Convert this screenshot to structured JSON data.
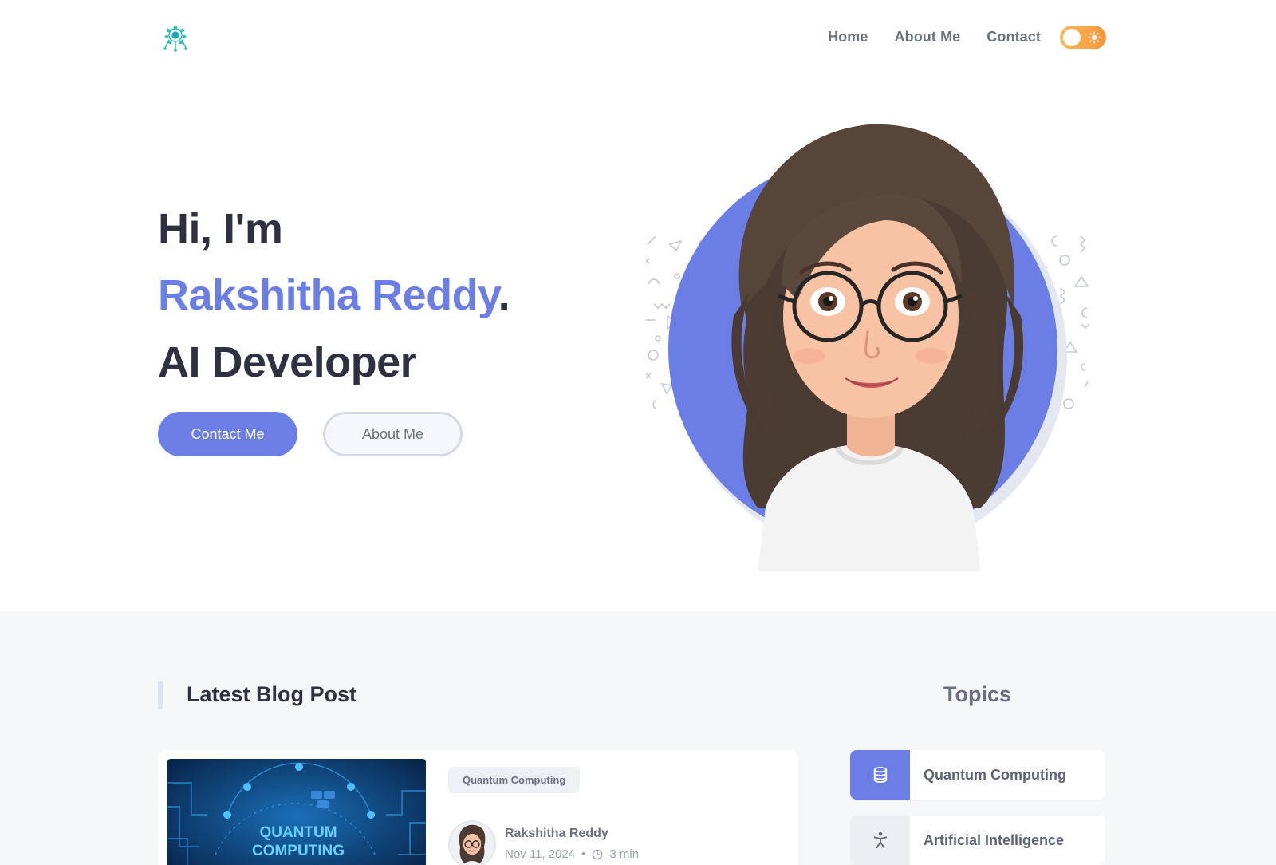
{
  "header": {
    "logo_icon": "neural-network-logo-icon",
    "nav": [
      {
        "label": "Home"
      },
      {
        "label": "About Me"
      },
      {
        "label": "Contact"
      }
    ],
    "theme_toggle_icon": "sun-icon",
    "accent_color": "#6b7ee6",
    "toggle_color": "#f7963a"
  },
  "hero": {
    "greeting": "Hi, I'm",
    "name": "Rakshitha Reddy",
    "name_suffix": ".",
    "role": "AI Developer",
    "primary_button": "Contact Me",
    "secondary_button": "About Me",
    "avatar_icon": "avatar-illustration"
  },
  "blog": {
    "section_title": "Latest Blog Post",
    "topics_title": "Topics",
    "post": {
      "tag": "Quantum Computing",
      "thumbnail_text_line1": "QUANTUM",
      "thumbnail_text_line2": "COMPUTING",
      "author": "Rakshitha Reddy",
      "date": "Nov 11, 2024",
      "read_time": "3 min",
      "meta_separator": "•"
    },
    "topics": [
      {
        "label": "Quantum Computing",
        "icon": "database-icon"
      },
      {
        "label": "Artificial Intelligence",
        "icon": "accessibility-icon"
      }
    ]
  }
}
